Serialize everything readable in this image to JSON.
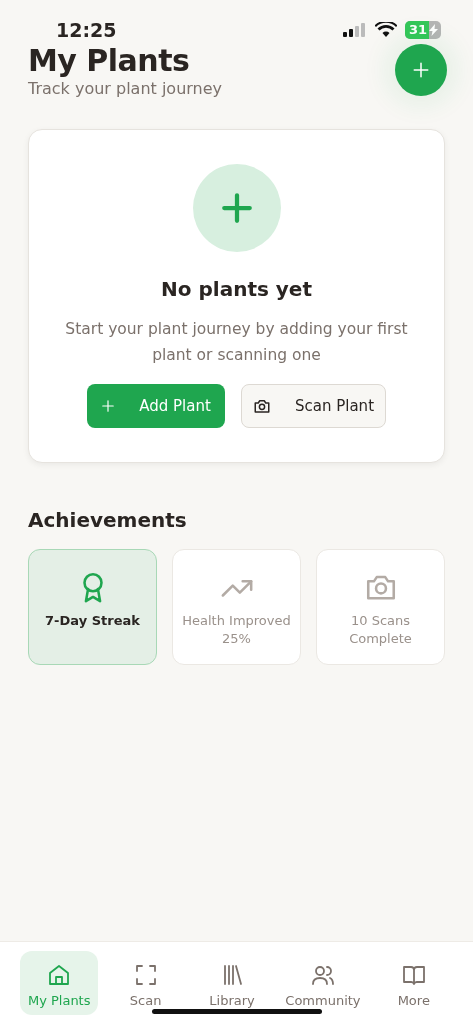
{
  "status_bar": {
    "time": "12:25",
    "battery": "31"
  },
  "header": {
    "title": "My Plants",
    "subtitle": "Track your plant journey"
  },
  "empty_state": {
    "title": "No plants yet",
    "message": "Start your plant journey by adding your first plant or scanning one",
    "buttons": [
      {
        "label": "Add Plant",
        "kind": "primary"
      },
      {
        "label": "Scan Plant",
        "kind": "secondary"
      }
    ]
  },
  "achievements": {
    "title": "Achievements",
    "items": [
      {
        "label": "7-Day Streak",
        "kind": "award",
        "unlocked": true
      },
      {
        "label": "Health Improved 25%",
        "kind": "trend",
        "unlocked": false
      },
      {
        "label": "10 Scans Complete",
        "kind": "camera",
        "unlocked": false
      }
    ]
  },
  "nav": [
    {
      "label": "My Plants",
      "kind": "home",
      "selected": true
    },
    {
      "label": "Scan",
      "kind": "scan",
      "selected": false
    },
    {
      "label": "Library",
      "kind": "library",
      "selected": false
    },
    {
      "label": "Community",
      "kind": "people",
      "selected": false
    },
    {
      "label": "More",
      "kind": "book",
      "selected": false
    }
  ]
}
